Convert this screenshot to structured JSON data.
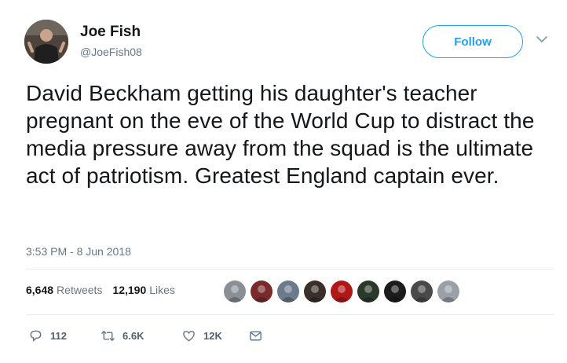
{
  "author": {
    "display_name": "Joe Fish",
    "handle": "@JoeFish08",
    "avatar_icon": "profile-photo"
  },
  "follow_button": {
    "label": "Follow",
    "accent": "#1da1f2"
  },
  "menu_icon": "chevron-down-icon",
  "tweet": {
    "text": "David Beckham getting his daughter's teacher pregnant on the eve of the World Cup to distract the media pressure away from the squad is the ultimate act of patriotism. Greatest England captain ever.",
    "timestamp": "3:53 PM - 8 Jun 2018"
  },
  "stats": {
    "retweets_count": "6,648",
    "retweets_label": "Retweets",
    "likes_count": "12,190",
    "likes_label": "Likes"
  },
  "likers": [
    {
      "color": "#8a8f96"
    },
    {
      "color": "#7a2a2a"
    },
    {
      "color": "#6b7b8c"
    },
    {
      "color": "#3a2f2a"
    },
    {
      "color": "#b01818"
    },
    {
      "color": "#2a3a2a"
    },
    {
      "color": "#1c1c1c"
    },
    {
      "color": "#4a4a4a"
    },
    {
      "color": "#9aa0a8"
    }
  ],
  "actions": {
    "reply_count": "112",
    "retweet_count": "6.6K",
    "like_count": "12K"
  }
}
